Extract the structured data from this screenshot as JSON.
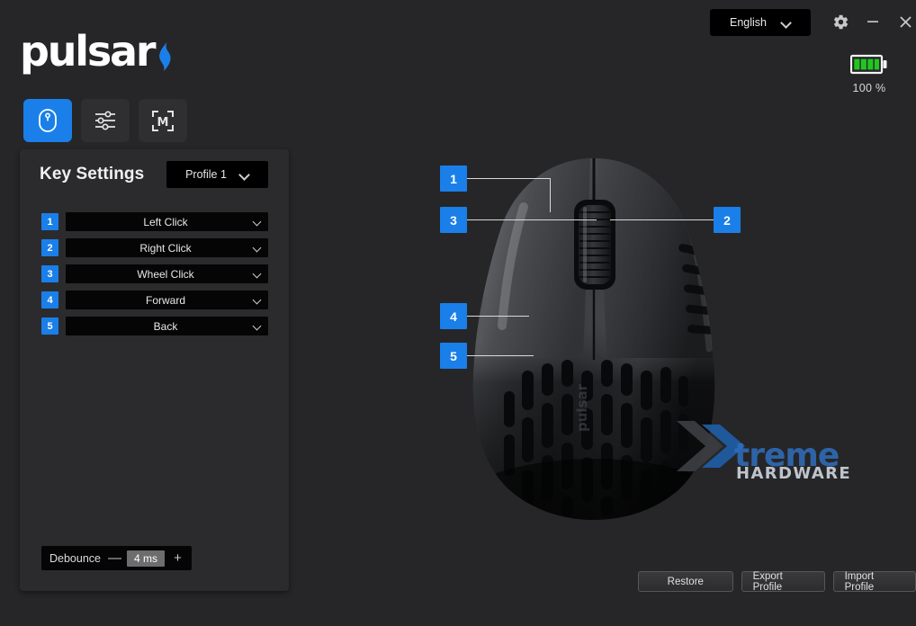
{
  "app": {
    "brand": "pulsar",
    "background_color": "#262628",
    "accent_color": "#1a7fe8"
  },
  "titlebar": {
    "language": {
      "value": "English",
      "chevron_icon": "chevron-down-icon"
    },
    "settings_icon": "gear-icon",
    "minimize_icon": "minimize-icon",
    "close_icon": "close-icon"
  },
  "battery": {
    "icon": "battery-full-icon",
    "percent_label": "100 %",
    "level": 100,
    "color": "#22c521"
  },
  "tabs": [
    {
      "id": "mouse",
      "icon": "mouse-icon",
      "active": true
    },
    {
      "id": "settings",
      "icon": "sliders-icon",
      "active": false
    },
    {
      "id": "macro",
      "icon": "macro-m-icon",
      "active": false
    }
  ],
  "key_settings": {
    "title": "Key Settings",
    "profile": {
      "value": "Profile 1",
      "chevron_icon": "chevron-down-icon"
    },
    "rows": [
      {
        "number": "1",
        "value": "Left Click"
      },
      {
        "number": "2",
        "value": "Right Click"
      },
      {
        "number": "3",
        "value": "Wheel Click"
      },
      {
        "number": "4",
        "value": "Forward"
      },
      {
        "number": "5",
        "value": "Back"
      }
    ],
    "debounce": {
      "label": "Debounce",
      "minus": "—",
      "value": "4 ms",
      "plus": "+"
    }
  },
  "mouse_preview": {
    "callouts": [
      {
        "number": "1"
      },
      {
        "number": "2"
      },
      {
        "number": "3"
      },
      {
        "number": "4"
      },
      {
        "number": "5"
      }
    ],
    "watermark": {
      "top_text": "treme",
      "bottom_text": "HARDWARE"
    }
  },
  "actions": {
    "restore": "Restore",
    "export_profile": "Export Profile",
    "import_profile": "Import Profile"
  }
}
